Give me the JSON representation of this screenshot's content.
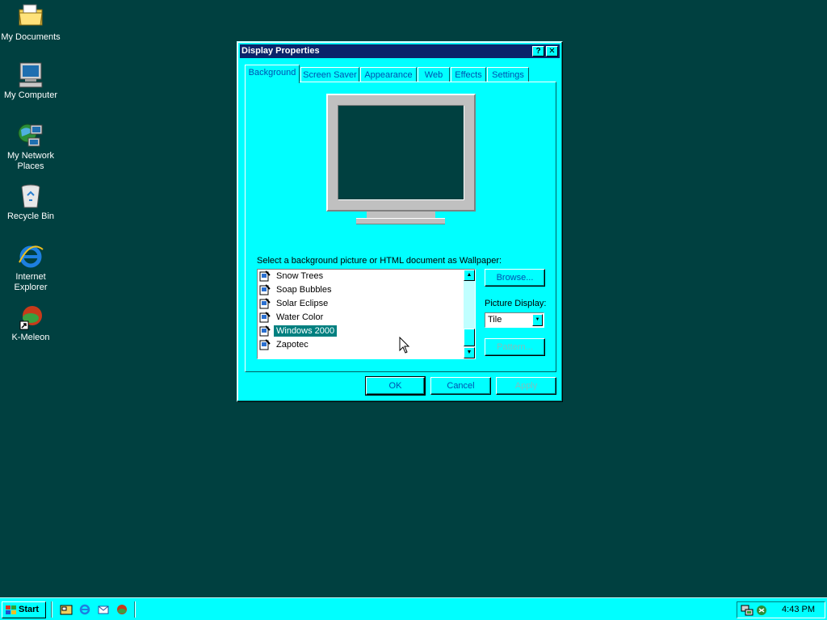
{
  "desktop": {
    "icons": [
      {
        "label": "My Documents",
        "icon": "folder-icon"
      },
      {
        "label": "My Computer",
        "icon": "computer-icon"
      },
      {
        "label_line1": "My Network",
        "label_line2": "Places",
        "icon": "network-icon"
      },
      {
        "label": "Recycle Bin",
        "icon": "recycle-bin-icon"
      },
      {
        "label_line1": "Internet",
        "label_line2": "Explorer",
        "icon": "ie-icon"
      },
      {
        "label": "K-Meleon",
        "icon": "kmeleon-icon"
      }
    ]
  },
  "dialog": {
    "title": "Display Properties",
    "help_btn": "?",
    "close_btn": "✕",
    "tabs": [
      "Background",
      "Screen Saver",
      "Appearance",
      "Web",
      "Effects",
      "Settings"
    ],
    "active_tab": "Background",
    "instruction": "Select a background picture or HTML document as Wallpaper:",
    "wallpapers": [
      "Snow Trees",
      "Soap Bubbles",
      "Solar Eclipse",
      "Water Color",
      "Windows 2000",
      "Zapotec"
    ],
    "selected_wallpaper": "Windows 2000",
    "browse_label": "Browse...",
    "picture_display_label": "Picture Display:",
    "picture_display_value": "Tile",
    "pattern_label": "Pattern...",
    "ok_label": "OK",
    "cancel_label": "Cancel",
    "apply_label": "Apply"
  },
  "taskbar": {
    "start_label": "Start",
    "clock": "4:43 PM"
  },
  "colors": {
    "desktop": "#004040",
    "window_face": "#00ffff",
    "title_bar": "#0a246a",
    "selection": "#008080"
  }
}
